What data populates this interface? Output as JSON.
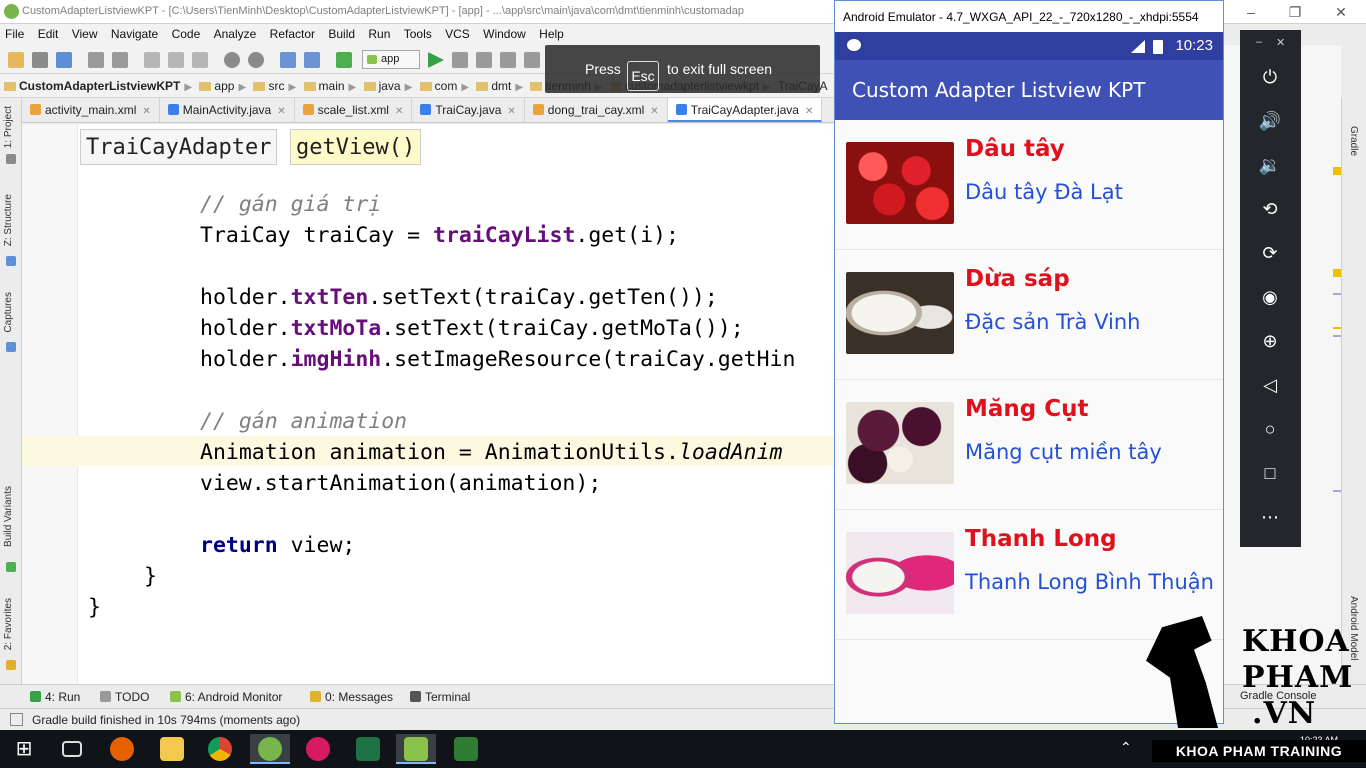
{
  "ide": {
    "title": "CustomAdapterListviewKPT - [C:\\Users\\TienMinh\\Desktop\\CustomAdapterListviewKPT] - [app] - ...\\app\\src\\main\\java\\com\\dmt\\tienminh\\customadap",
    "menu": [
      "File",
      "Edit",
      "View",
      "Navigate",
      "Code",
      "Analyze",
      "Refactor",
      "Build",
      "Run",
      "Tools",
      "VCS",
      "Window",
      "Help"
    ],
    "run_config": "app",
    "breadcrumb": [
      "CustomAdapterListviewKPT",
      "app",
      "src",
      "main",
      "java",
      "com",
      "dmt",
      "tienminh",
      "customadapterlistviewkpt",
      "TraiCayA"
    ],
    "tabs": [
      {
        "label": "activity_main.xml",
        "color": "#e8a33d"
      },
      {
        "label": "MainActivity.java",
        "color": "#3d7fe8"
      },
      {
        "label": "scale_list.xml",
        "color": "#e8a33d"
      },
      {
        "label": "TraiCay.java",
        "color": "#3d7fe8"
      },
      {
        "label": "dong_trai_cay.xml",
        "color": "#e8a33d"
      },
      {
        "label": "TraiCayAdapter.java",
        "color": "#3d7fe8"
      }
    ],
    "method_crumbs": [
      "TraiCayAdapter",
      "getView()"
    ],
    "left_tools": [
      "1: Project",
      "Z: Structure",
      "Captures",
      "Build Variants",
      "2: Favorites"
    ],
    "right_tools": [
      "Gradle",
      "Android Model"
    ],
    "bottom_tools": [
      "4: Run",
      "TODO",
      "6: Android Monitor",
      "0: Messages",
      "Terminal",
      "Gradle Console"
    ],
    "status": "Gradle build finished in 10s 794ms (moments ago)"
  },
  "fullscreen_hint": {
    "press": "Press",
    "key": "Esc",
    "rest": "to exit full screen"
  },
  "code": {
    "comment1": "// gán giá trị",
    "l1a": "TraiCay traiCay = ",
    "l1b": "traiCayList",
    "l1c": ".get(i);",
    "l2a": "holder.",
    "l2b": "txtTen",
    "l2c": ".setText(traiCay.getTen());",
    "l3a": "holder.",
    "l3b": "txtMoTa",
    "l3c": ".setText(traiCay.getMoTa());",
    "l4a": "holder.",
    "l4b": "imgHinh",
    "l4c": ".setImageResource(traiCay.getHin",
    "comment2": "// gán animation",
    "l5a": "Animation animation = AnimationUtils.",
    "l5b": "loadAnim",
    "l6": "view.startAnimation(animation);",
    "l7a": "return",
    "l7b": " view;",
    "brace1": "}",
    "brace2": "}"
  },
  "emulator": {
    "window_title": "Android Emulator - 4.7_WXGA_API_22_-_720x1280_-_xhdpi:5554",
    "time": "10:23",
    "app_title": "Custom Adapter Listview KPT",
    "items": [
      {
        "name": "Dâu tây",
        "desc": "Dâu tây Đà Lạt"
      },
      {
        "name": "Dừa sáp",
        "desc": "Đặc sản Trà Vinh"
      },
      {
        "name": "Măng Cụt",
        "desc": "Măng cụt miền tây"
      },
      {
        "name": "Thanh Long",
        "desc": "Thanh Long Bình Thuận"
      }
    ],
    "controls": [
      "power-icon",
      "volume-up-icon",
      "volume-down-icon",
      "rotate-left-icon",
      "rotate-right-icon",
      "camera-icon",
      "zoom-icon",
      "back-icon",
      "home-icon",
      "overview-icon",
      "more-icon"
    ]
  },
  "watermark": {
    "lines": [
      "KHOA",
      "PHAM",
      ".VN"
    ],
    "banner": "KHOA PHAM TRAINING"
  },
  "taskbar": {
    "apps": [
      "start-icon",
      "task-view-icon",
      "firefox-icon",
      "file-explorer-icon",
      "chrome-icon",
      "android-studio-icon",
      "app-oo-icon",
      "excel-icon",
      "android-sdk-icon",
      "camtasia-icon"
    ],
    "clock": "10:23 AM"
  }
}
